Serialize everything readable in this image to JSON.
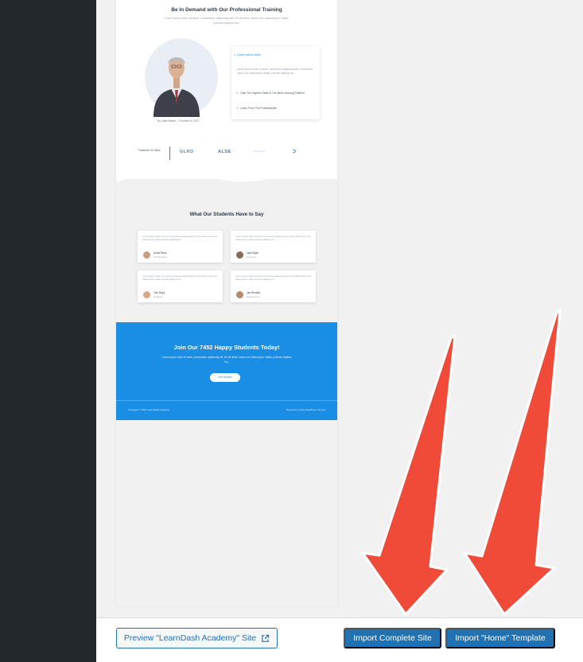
{
  "preview": {
    "hero_title": "Be In Demand with Our Professional Training",
    "hero_subtitle": "Lorem ipsum dolor sit amet, consectetur adipiscing elit. Ut elit tellus, luctus nec ullamcorper mattis, pulvinar dapibus leo.",
    "caption": "By Jake Martin – Founder & CEO",
    "features": {
      "head": "Lorem ipsum dolor",
      "body": "Lorem ipsum dolor sit amet, consectetur adipiscing elit. Ut elit tellus, luctus nec ullamcorper mattis, pulvinar dapibus leo.",
      "item1": "Gain The Highest Skills In The Best Learning Platform",
      "item2": "Learn From The Professionals"
    },
    "logos": {
      "label": "Featured On Sites",
      "items": [
        "GLRD",
        "ALSE",
        "~~~~",
        "Ↄ"
      ]
    },
    "testimonials_title": "What Our Students Have to Say",
    "testimonials": [
      {
        "text": "Lorem ipsum dolor sit amet consectetur adipiscing elit ut elit tellus luctus nec ullamcorper mattis pulvinar dapibus leo.",
        "name": "Annie Ross",
        "role": "Photographer"
      },
      {
        "text": "Lorem ipsum dolor sit amet consectetur adipiscing elit ut elit tellus luctus nec ullamcorper mattis pulvinar dapibus leo.",
        "name": "Jack Ryan",
        "role": "Developer"
      },
      {
        "text": "Lorem ipsum dolor sit amet consectetur adipiscing elit ut elit tellus luctus nec ullamcorper mattis pulvinar dapibus leo.",
        "name": "Tom Hays",
        "role": "Designer"
      },
      {
        "text": "Lorem ipsum dolor sit amet consectetur adipiscing elit ut elit tellus luctus nec ullamcorper mattis pulvinar dapibus leo.",
        "name": "Jan Rhodes",
        "role": "Entrepreneur"
      }
    ],
    "cta": {
      "title": "Join Our 7452 Happy Students Today!",
      "subtitle": "Lorem ipsum dolor sit amet, consectetur adipiscing elit. Ut elit tellus, luctus nec ullamcorper mattis, pulvinar dapibus leo.",
      "button": "Get Started"
    },
    "footer_left": "Copyright © 2024 LearnDash Academy",
    "footer_right": "Powered by Astra WordPress Theme"
  },
  "actions": {
    "preview_label": "Preview \"LearnDash Academy\" Site",
    "import_site_label": "Import Complete Site",
    "import_home_label": "Import \"Home\" Template"
  },
  "colors": {
    "sidebar": "#23282d",
    "accent": "#2271b1",
    "cta_blue": "#1a8de4",
    "arrow": "#f04a38"
  }
}
